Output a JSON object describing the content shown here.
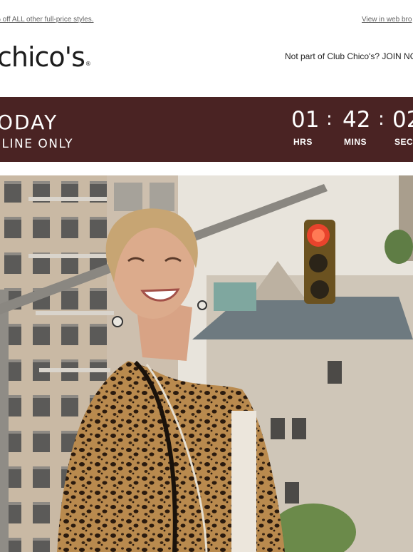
{
  "preheader": {
    "left_text": "% off ALL other full-price styles.",
    "right_link": "View in web bro"
  },
  "header": {
    "logo_text": "chico's",
    "logo_mark": "®",
    "join_text": "Not part of Club Chico's? JOIN NO"
  },
  "countdown": {
    "headline": "ODAY",
    "subhead": "ILINE ONLY",
    "hours": "01",
    "hours_label": "HRS",
    "minutes": "42",
    "minutes_label": "MINS",
    "seconds": "02",
    "seconds_label": "SECS",
    "separator": ":",
    "band_color": "#4a2323"
  },
  "hero": {
    "image_alt": "smiling woman in leopard print jacket on city street",
    "icon": "hero-photo"
  }
}
